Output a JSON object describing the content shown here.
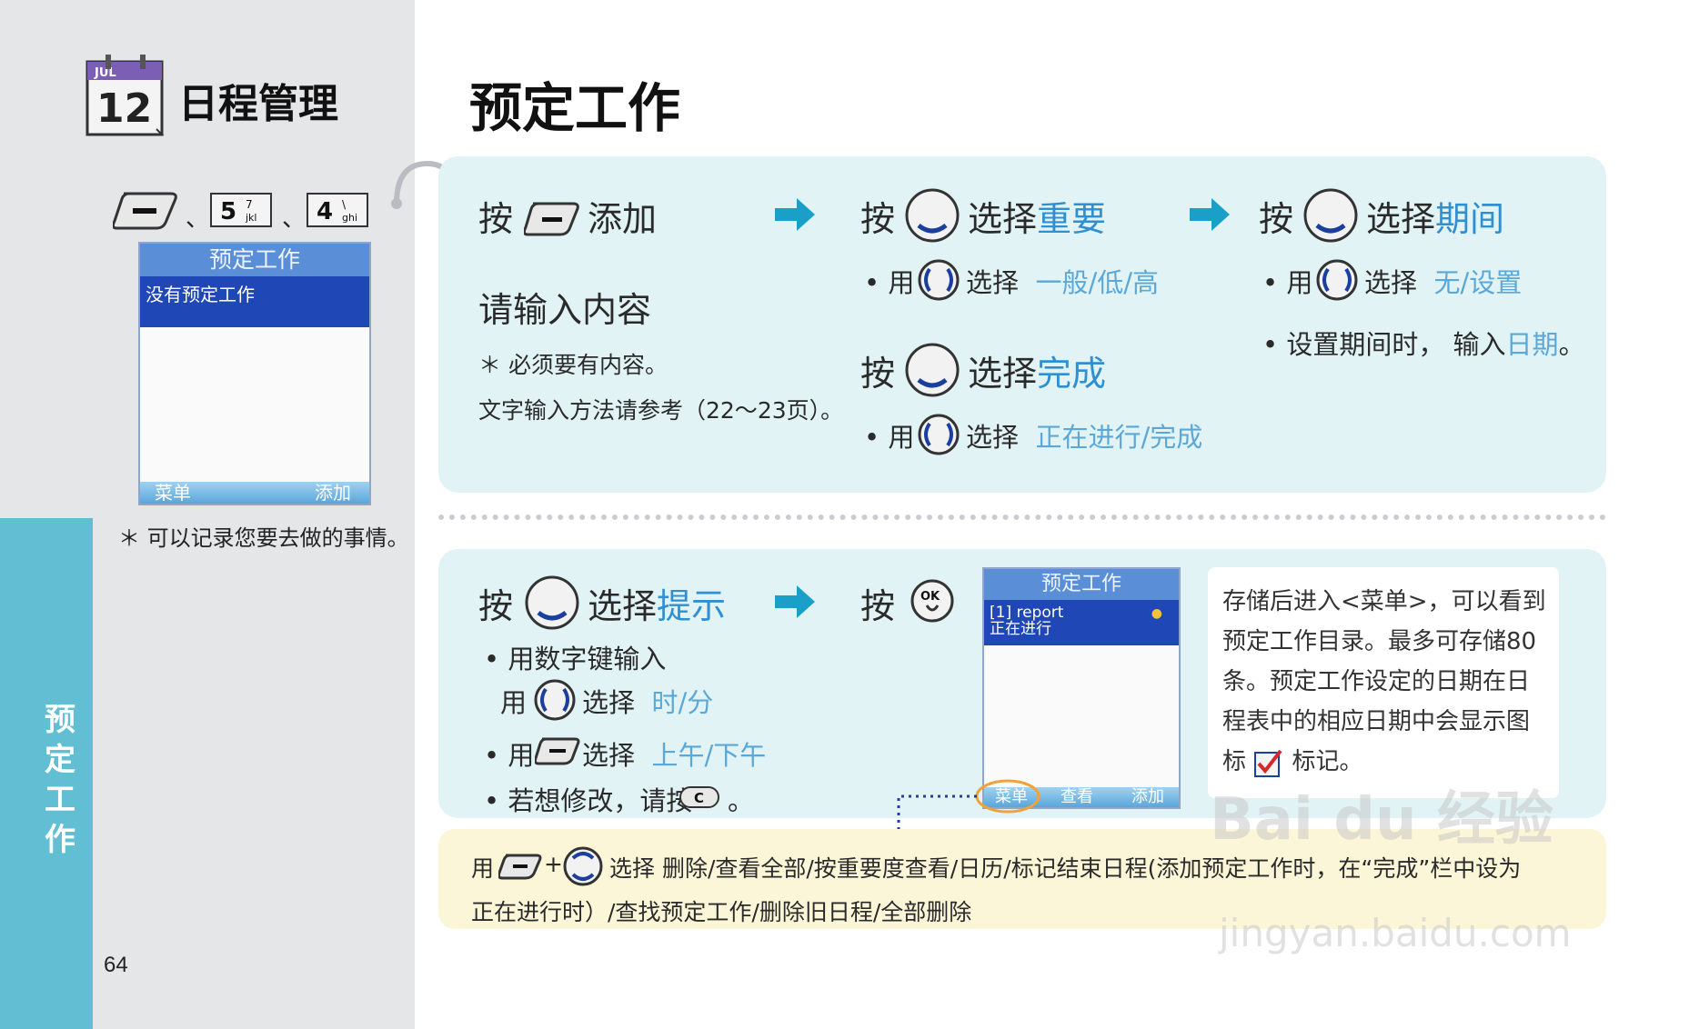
{
  "sidebar": {
    "chapter_number": "12",
    "calendar_month": "JUL",
    "chapter_title": "日程管理",
    "key_sequence": [
      "5",
      "4"
    ],
    "key_sub": [
      "7\njkl",
      "\\\nghi"
    ],
    "key_separator": "、",
    "phone": {
      "header": "预定工作",
      "selected_item": "没有预定工作",
      "softkey_left": "菜单",
      "softkey_right": "添加"
    },
    "note": "＊ 可以记录您要去做的事情。",
    "tab_label": "预\n定\n工\n作",
    "page_number": "64"
  },
  "main": {
    "title": "预定工作",
    "step1": {
      "press": "按",
      "action": "添加",
      "prompt": "请输入内容",
      "note1": "＊ 必须要有内容。",
      "note2": "文字输入方法请参考（22～23页）。"
    },
    "step2": {
      "press": "按",
      "select": "选择",
      "target": "重要",
      "bullet_use": "• 用",
      "bullet_select": "选择",
      "options": "一般/低/高",
      "press2": "按",
      "select2": "选择",
      "target2": "完成",
      "bullet2_use": "• 用",
      "bullet2_select": "选择",
      "options2": "正在进行/完成"
    },
    "step3": {
      "press": "按",
      "select": "选择",
      "target": "期间",
      "bullet_use": "• 用",
      "bullet_select": "选择",
      "options": "无/设置",
      "bullet2": "• 设置期间时， 输入",
      "bullet2_target": "日期",
      "bullet2_end": "。"
    },
    "step4": {
      "press": "按",
      "select": "选择",
      "target": "提示",
      "b1": "• 用数字键输入",
      "b1_use": "用",
      "b1_select": "选择",
      "b1_options": "时/分",
      "b2_use": "• 用",
      "b2_select": "选择",
      "b2_options": "上午/下午",
      "b3": "• 若想修改，请按",
      "b3_end": "。",
      "key_c": "C"
    },
    "step5": {
      "press": "按",
      "ok_label": "OK"
    },
    "phone2": {
      "header": "预定工作",
      "item_line1": "[1] report",
      "item_line2": "正在进行",
      "softkeys": [
        "菜单",
        "查看",
        "添加"
      ]
    },
    "info": "存储后进入<菜单>，可以看到预定工作目录。最多可存储80条。预定工作设定的日期在日程表中的相应日期中会显示图标",
    "info_end": "标记。",
    "footer_use": "用",
    "footer_plus": "+",
    "footer_text_1": "选择 删除/查看全部/按重要度查看/日历/标记结束日程(添加预定工作时，在“完成”栏中设为",
    "footer_text_2": "正在进行时）/查找预定工作/删除旧日程/全部删除"
  },
  "watermark": {
    "brand": "Bai du 经验",
    "url": "jingyan.baidu.com"
  },
  "colors": {
    "accent_blue": "#2f8fd0",
    "panel_teal": "#e1f3f5",
    "tab_teal": "#62bfd3",
    "footer_yellow": "#fcf6d8",
    "arrow": "#1aa0c8"
  }
}
